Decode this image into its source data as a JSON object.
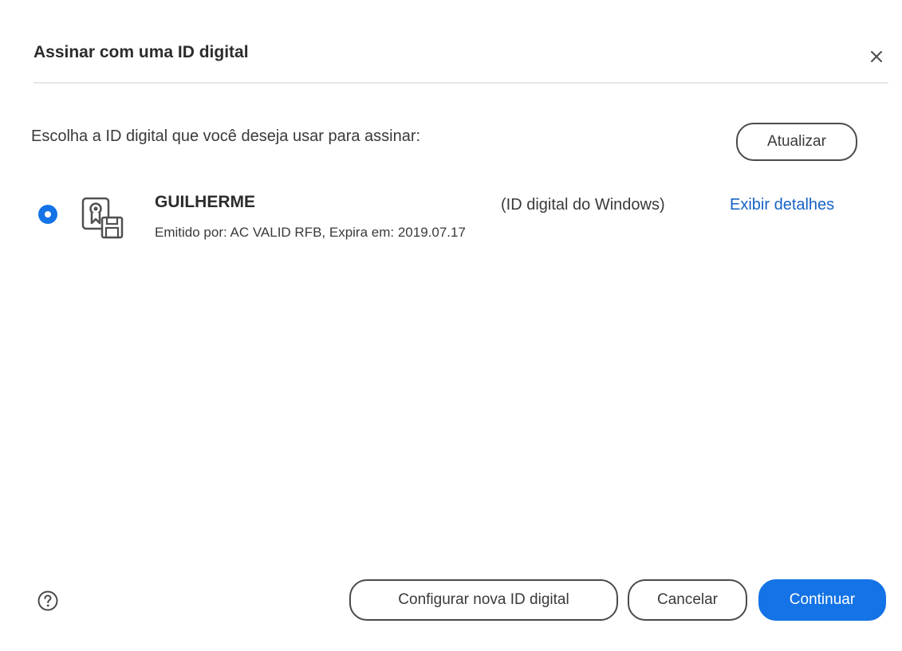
{
  "dialog": {
    "title": "Assinar com uma ID digital",
    "close_icon": "close-icon"
  },
  "content": {
    "prompt": "Escolha a ID digital que você deseja usar para assinar:",
    "refresh_label": "Atualizar",
    "digital_ids": [
      {
        "selected": true,
        "name": "GUILHERME",
        "type": "(ID digital do Windows)",
        "details_link": "Exibir detalhes",
        "issuer_line": "Emitido por: AC VALID RFB, Expira em: 2019.07.17",
        "icon": "certificate-icon"
      }
    ]
  },
  "footer": {
    "help_icon": "help-icon",
    "configure_label": "Configurar nova ID digital",
    "cancel_label": "Cancelar",
    "continue_label": "Continuar"
  },
  "colors": {
    "accent": "#1473e6",
    "link": "#1662c6",
    "text": "#2c2c2c",
    "divider": "#e6e6e6"
  }
}
